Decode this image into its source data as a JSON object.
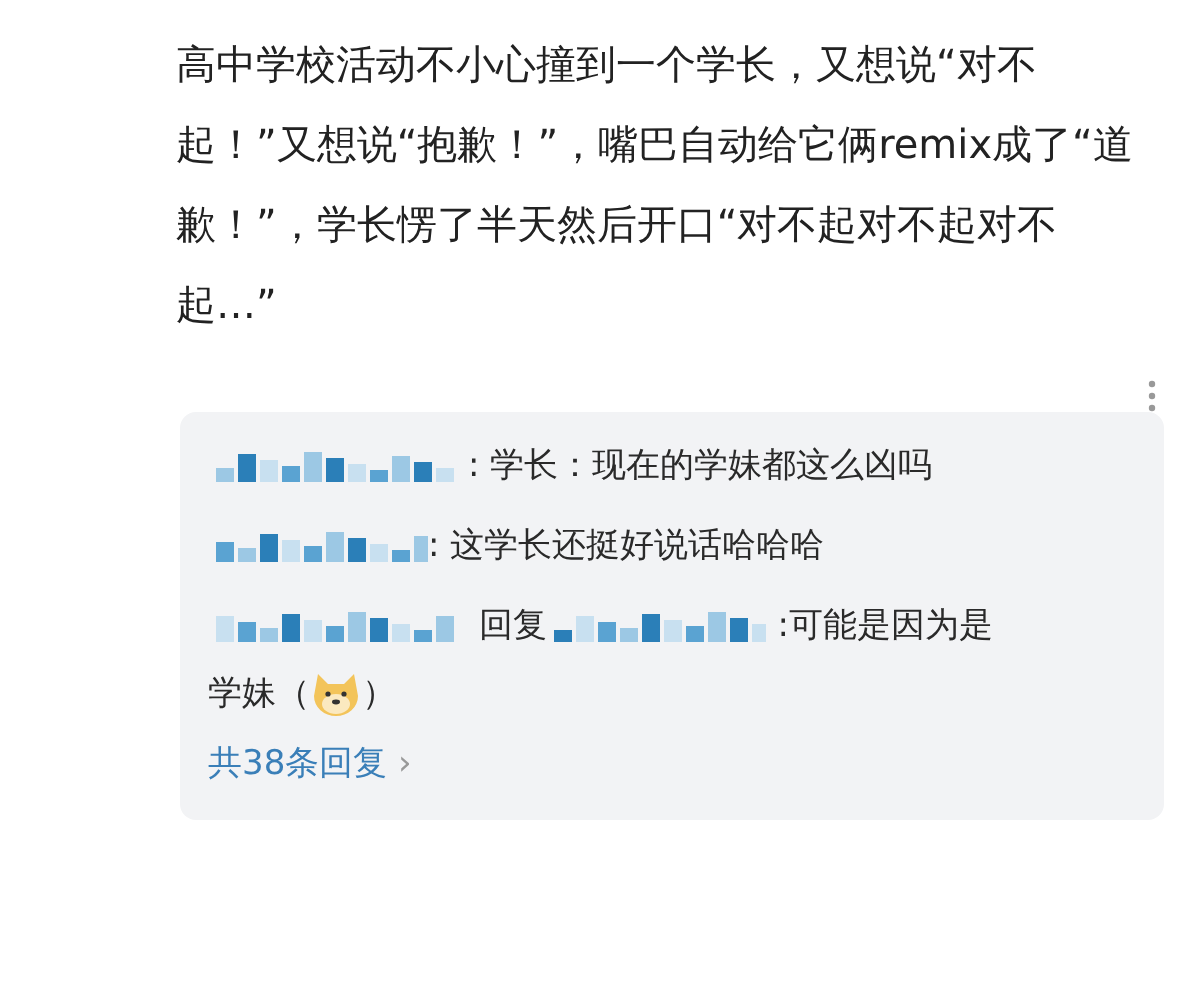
{
  "post": {
    "text": "高中学校活动不小心撞到一个学长，又想说“对不起！”又想说“抱歉！”，嘴巴自动给它俩remix成了“道歉！”，学长愣了半天然后开口“对不起对不起对不起…”"
  },
  "replies": [
    {
      "parts": [
        {
          "kind": "redacted"
        },
        {
          "kind": "text",
          "text": ": 学长：现在的学妹都这么凶"
        },
        {
          "kind": "text",
          "text": "吗"
        }
      ]
    },
    {
      "parts": [
        {
          "kind": "redacted"
        },
        {
          "kind": "text",
          "text": ": 这学长还挺好说话哈哈哈"
        }
      ]
    },
    {
      "parts": [
        {
          "kind": "redacted"
        },
        {
          "kind": "text",
          "text": " 回复"
        },
        {
          "kind": "redacted"
        },
        {
          "kind": "text",
          "text": " :可能是因为是"
        },
        {
          "kind": "text",
          "text": "学妹（"
        },
        {
          "kind": "emoji"
        },
        {
          "kind": "text",
          "text": "）"
        }
      ]
    }
  ],
  "more_replies": {
    "label": "共38条回复",
    "chevron": "›"
  }
}
